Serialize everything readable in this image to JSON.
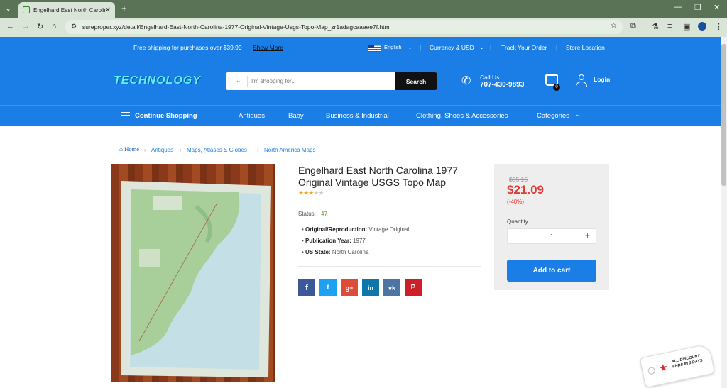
{
  "browser": {
    "tab_title": "Engelhard East North Carolina",
    "url": "sureproper.xyz/detail/Engelhard-East-North-Carolina-1977-Original-Vintage-Usgs-Topo-Map_zr1adagcaaeee7f.html"
  },
  "topbar": {
    "shipping_text": "Free shipping for purchases over $39.99",
    "show_more": "Show More",
    "language": "English",
    "currency": "Currency & USD",
    "track_order": "Track Your Order",
    "store_location": "Store Location"
  },
  "header": {
    "logo": "TECHNOLOGY",
    "search_placeholder": "I'm shopping for...",
    "search_button": "Search",
    "call_label": "Call Us",
    "phone": "707-430-9893",
    "cart_count": "0",
    "login": "Login"
  },
  "nav": {
    "continue": "Continue Shopping",
    "items": [
      "Antiques",
      "Baby",
      "Business & Industrial",
      "Clothing, Shoes & Accessories",
      "Categories"
    ]
  },
  "breadcrumb": {
    "home": "Home",
    "items": [
      "Antiques",
      "Maps, Atlases & Globes",
      "North America Maps"
    ]
  },
  "product": {
    "title": "Engelhard East North Carolina 1977 Original Vintage USGS Topo Map",
    "rating": 3,
    "status_label": "Status:",
    "status_value": "47",
    "specs": [
      {
        "label": "Original/Reproduction:",
        "value": "Vintage Original"
      },
      {
        "label": "Publication Year:",
        "value": "1977"
      },
      {
        "label": "US State:",
        "value": "North Carolina"
      }
    ]
  },
  "price": {
    "old": "$35.15",
    "current": "$21.09",
    "discount": "(-40%)",
    "quantity_label": "Quantity",
    "quantity": "1",
    "add_to_cart": "Add to cart"
  },
  "badge": {
    "text": "ALL DISCOUNT ENDS IN 3 DAYS"
  },
  "colors": {
    "brand_blue": "#1a7ee6",
    "price_red": "#e53935"
  }
}
